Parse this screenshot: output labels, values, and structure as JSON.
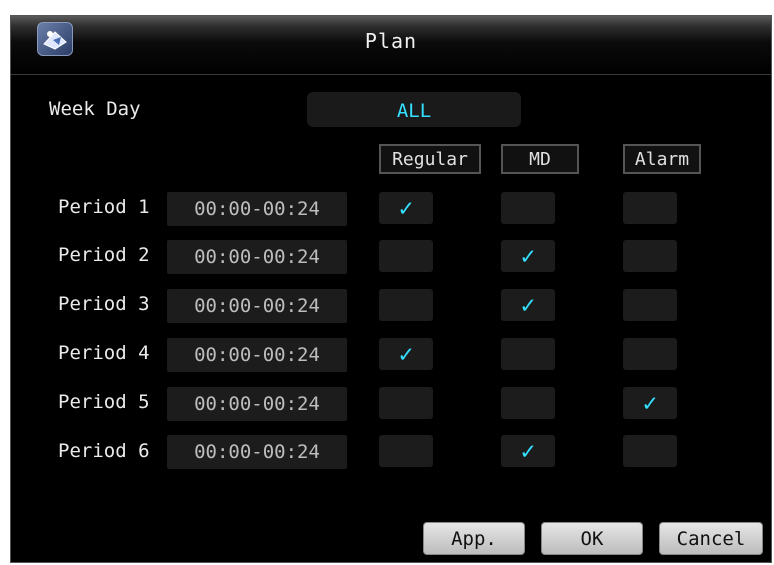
{
  "window": {
    "title": "Plan"
  },
  "weekday": {
    "label": "Week Day",
    "value": "ALL"
  },
  "columns": {
    "regular": "Regular",
    "md": "MD",
    "alarm": "Alarm"
  },
  "periods": [
    {
      "label": "Period 1",
      "time": "00:00-00:24",
      "regular": "✓",
      "md": "",
      "alarm": ""
    },
    {
      "label": "Period 2",
      "time": "00:00-00:24",
      "regular": "",
      "md": "✓",
      "alarm": ""
    },
    {
      "label": "Period 3",
      "time": "00:00-00:24",
      "regular": "",
      "md": "✓",
      "alarm": ""
    },
    {
      "label": "Period 4",
      "time": "00:00-00:24",
      "regular": "✓",
      "md": "",
      "alarm": ""
    },
    {
      "label": "Period 5",
      "time": "00:00-00:24",
      "regular": "",
      "md": "",
      "alarm": "✓"
    },
    {
      "label": "Period 6",
      "time": "00:00-00:24",
      "regular": "",
      "md": "✓",
      "alarm": ""
    }
  ],
  "buttons": {
    "apply": "App.",
    "ok": "OK",
    "cancel": "Cancel"
  },
  "colors": {
    "accent": "#33e0ff",
    "background": "#000000",
    "field": "#1c1c1c"
  }
}
